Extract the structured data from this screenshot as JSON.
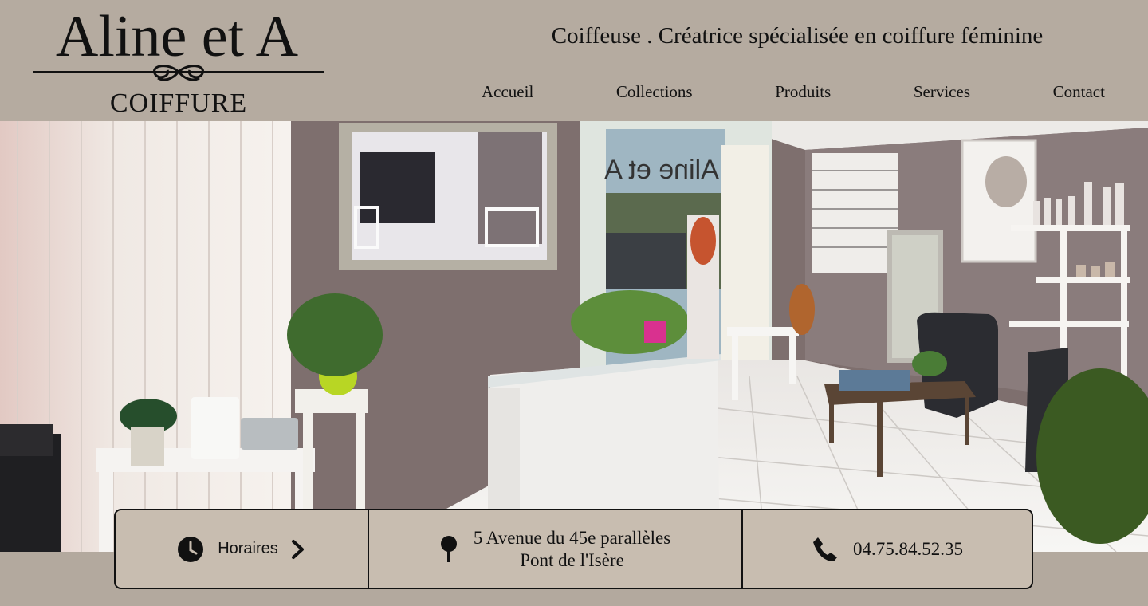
{
  "brand": {
    "logo_line1": "Aline et A",
    "logo_line2": "COIFFURE"
  },
  "header": {
    "tagline": "Coiffeuse . Créatrice spécialisée en coiffure féminine"
  },
  "nav": {
    "items": [
      {
        "label": "Accueil"
      },
      {
        "label": "Collections"
      },
      {
        "label": "Produits"
      },
      {
        "label": "Services"
      },
      {
        "label": "Contact"
      }
    ]
  },
  "hero": {
    "window_lettering": "Aline et A",
    "icon": "salon-interior-photo"
  },
  "info": {
    "hours": {
      "label": "Horaires",
      "icon": "clock-icon",
      "arrow_icon": "chevron-right-icon"
    },
    "address": {
      "line1": "5 Avenue du 45e parallèles",
      "line2": "Pont de l'Isère",
      "icon": "map-pin-icon"
    },
    "phone": {
      "number": "04.75.84.52.35",
      "icon": "phone-icon"
    }
  },
  "colors": {
    "header_bg": "#b5aba0",
    "infobar_bg": "#c8bdb0",
    "text": "#111111"
  }
}
